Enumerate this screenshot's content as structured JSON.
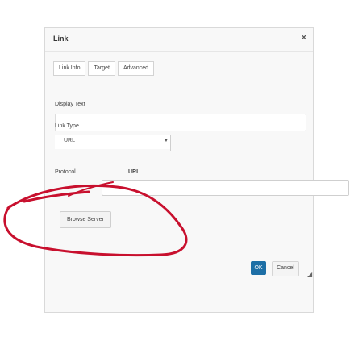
{
  "dialog": {
    "title": "Link",
    "close_icon": "×"
  },
  "tabs": [
    {
      "label": "Link Info"
    },
    {
      "label": "Target"
    },
    {
      "label": "Advanced"
    }
  ],
  "fields": {
    "display_text_label": "Display Text",
    "display_text_value": "",
    "link_type_label": "Link Type",
    "link_type_value": "URL",
    "protocol_label": "Protocol",
    "url_label": "URL",
    "url_value": ""
  },
  "buttons": {
    "browse_server": "Browse Server",
    "ok": "OK",
    "cancel": "Cancel"
  },
  "colors": {
    "accent": "#1d6fa6",
    "scribble": "#c8102e"
  }
}
